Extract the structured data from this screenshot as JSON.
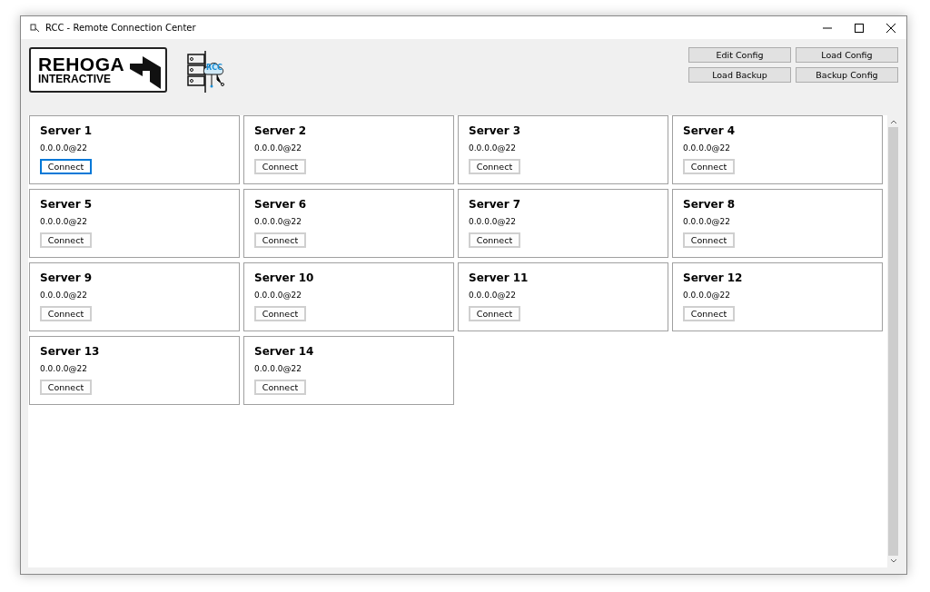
{
  "window": {
    "title": "RCC - Remote Connection Center"
  },
  "logo": {
    "line_1": "REHOGA",
    "line_2": "INTERACTIVE",
    "badge": "RCC"
  },
  "toolbar": {
    "buttons": [
      "Edit Config",
      "Load Config",
      "Load Backup",
      "Backup Config"
    ]
  },
  "servers": [
    {
      "name": "Server 1",
      "address": "0.0.0.0@22",
      "button": "Connect",
      "focused": true
    },
    {
      "name": "Server 2",
      "address": "0.0.0.0@22",
      "button": "Connect",
      "focused": false
    },
    {
      "name": "Server 3",
      "address": "0.0.0.0@22",
      "button": "Connect",
      "focused": false
    },
    {
      "name": "Server 4",
      "address": "0.0.0.0@22",
      "button": "Connect",
      "focused": false
    },
    {
      "name": "Server 5",
      "address": "0.0.0.0@22",
      "button": "Connect",
      "focused": false
    },
    {
      "name": "Server 6",
      "address": "0.0.0.0@22",
      "button": "Connect",
      "focused": false
    },
    {
      "name": "Server 7",
      "address": "0.0.0.0@22",
      "button": "Connect",
      "focused": false
    },
    {
      "name": "Server 8",
      "address": "0.0.0.0@22",
      "button": "Connect",
      "focused": false
    },
    {
      "name": "Server 9",
      "address": "0.0.0.0@22",
      "button": "Connect",
      "focused": false
    },
    {
      "name": "Server 10",
      "address": "0.0.0.0@22",
      "button": "Connect",
      "focused": false
    },
    {
      "name": "Server 11",
      "address": "0.0.0.0@22",
      "button": "Connect",
      "focused": false
    },
    {
      "name": "Server 12",
      "address": "0.0.0.0@22",
      "button": "Connect",
      "focused": false
    },
    {
      "name": "Server 13",
      "address": "0.0.0.0@22",
      "button": "Connect",
      "focused": false
    },
    {
      "name": "Server 14",
      "address": "0.0.0.0@22",
      "button": "Connect",
      "focused": false
    }
  ]
}
